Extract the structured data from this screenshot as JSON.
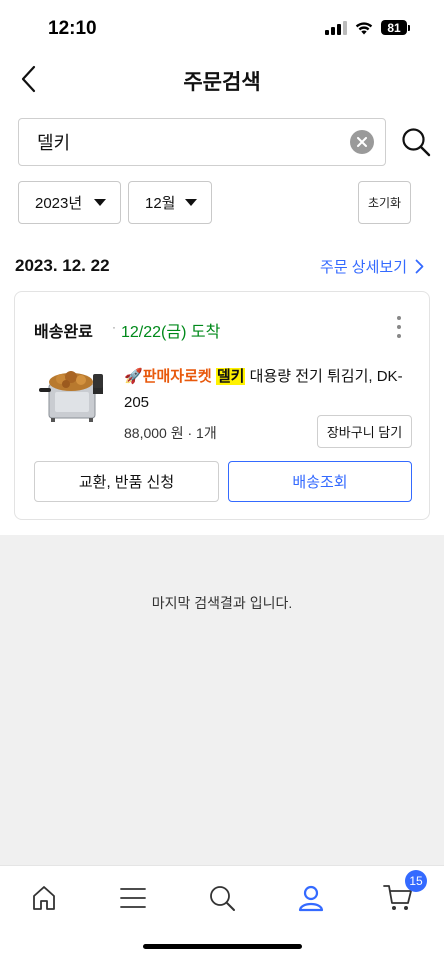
{
  "status_bar": {
    "time": "12:10",
    "battery": "81"
  },
  "header": {
    "title": "주문검색",
    "back_icon": "chevron-left-icon"
  },
  "search": {
    "value": "델키",
    "clear_icon": "clear-circle-icon",
    "search_icon": "search-icon"
  },
  "filters": {
    "year": "2023년",
    "month": "12월",
    "reset_label": "초기화"
  },
  "order": {
    "date": "2023. 12. 22",
    "detail_link": "주문 상세보기",
    "status": "배송완료",
    "separator": "·",
    "delivery_date": "12/22(금) 도착",
    "product": {
      "rocket_label": "판매자로켓",
      "brand": "델키",
      "name": "대용량 전기 튀김기, DK-205",
      "price": "88,000 원",
      "quantity": "1개",
      "price_sep": "·"
    },
    "add_cart_label": "장바구니 담기",
    "exchange_label": "교환, 반품 신청",
    "track_label": "배송조회"
  },
  "end_message": "마지막 검색결과 입니다.",
  "bottom_nav": {
    "items": [
      "home-icon",
      "menu-icon",
      "search-icon",
      "my-account-icon",
      "cart-icon"
    ],
    "cart_count": "15"
  },
  "colors": {
    "accent": "#346aff",
    "delivered_green": "#00891a",
    "rocket_orange": "#e8590c",
    "highlight_yellow": "#fff200"
  }
}
